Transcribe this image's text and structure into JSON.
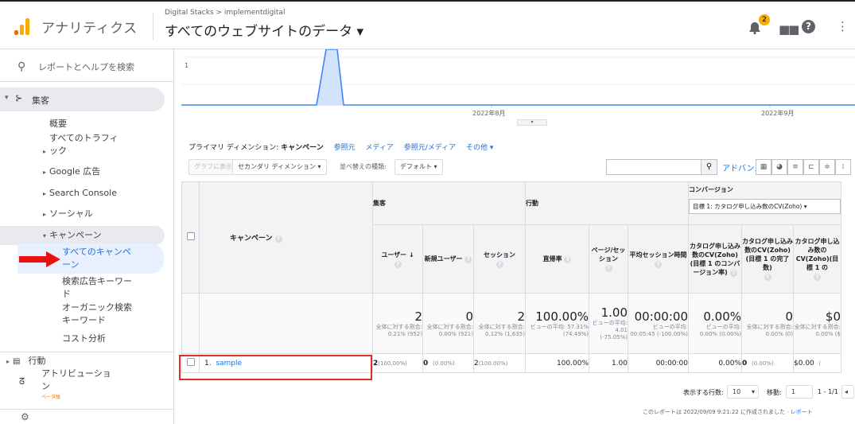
{
  "header": {
    "product": "アナリティクス",
    "breadcrumb": "Digital Stacks > implementdigital",
    "account_view": "すべてのウェブサイトのデータ ▾",
    "notification_count": "2",
    "help_label": "?"
  },
  "sidebar": {
    "search_label": "レポートとヘルプを検索",
    "acquisition": "集客",
    "overview": "概要",
    "all_traffic_1": "すべてのトラフィ",
    "all_traffic_2": "ック",
    "google_ads": "Google 広告",
    "search_console": "Search Console",
    "social": "ソーシャル",
    "campaigns": "キャンペーン",
    "all_campaigns_1": "すべてのキャンペ",
    "all_campaigns_2": "ーン",
    "paid_keywords_1": "検索広告キーワー",
    "paid_keywords_2": "ド",
    "organic_keywords_1": "オーガニック検索",
    "organic_keywords_2": "キーワード",
    "cost_analysis": "コスト分析",
    "behavior": "行動",
    "attribution_1": "アトリビューショ",
    "attribution_2": "ン",
    "beta_label": "ベータ版"
  },
  "chart": {
    "y_tick": "1",
    "x_label_1": "2022年8月",
    "x_label_2": "2022年9月"
  },
  "dimension_bar": {
    "primary_label": "プライマリ ディメンション:",
    "primary_value": "キャンペーン",
    "links": [
      "参照元",
      "メディア",
      "参照元/メディア",
      "その他 ▾"
    ]
  },
  "toolbar": {
    "plot_rows": "グラフに表示",
    "secondary_dimension": "セカンダリ ディメンション ▾",
    "sort_type_label": "並べ替えの種類:",
    "sort_type_value": "デフォルト ▾",
    "advanced": "アドバンス"
  },
  "table": {
    "group_acquisition": "集客",
    "group_behavior": "行動",
    "group_conversion": "コンバージョン",
    "goal_select": "目標 1: カタログ申し込み数のCV(Zoho) ▾",
    "col_campaign": "キャンペーン",
    "col_users": "ユーザー",
    "col_new_users": "新規ユーザー",
    "col_sessions": "セッション",
    "col_bounce": "直帰率",
    "col_pages_session": "ページ/セッション",
    "col_avg_duration": "平均セッション時間",
    "col_goal_cvr": "カタログ申し込み数のCV(Zoho)(目標 1 のコンバージョン率)",
    "col_goal_completions": "カタログ申し込み数のCV(Zoho)(目標 1 の完了数)",
    "col_goal_value": "カタログ申し込み数のCV(Zoho)(目標 1 の",
    "totals": {
      "users": "2",
      "users_sub": "全体に対する割合: 0.21% (952)",
      "new_users": "0",
      "new_users_sub": "全体に対する割合: 0.00% (921)",
      "sessions": "2",
      "sessions_sub": "全体に対する割合: 0.12% (1,635)",
      "bounce": "100.00%",
      "bounce_sub": "ビューの平均: 57.31% (74.49%)",
      "pages": "1.00",
      "pages_sub": "ビューの平均: 4.01 (-75.05%)",
      "duration": "00:00:00",
      "duration_sub": "ビューの平均: 00:05:45 (-100.00%)",
      "cvr": "0.00%",
      "cvr_sub": "ビューの平均: 0.00% (0.00%)",
      "completions": "0",
      "completions_sub": "全体に対する割合: 0.00% (0)",
      "value": "$0",
      "value_sub": "全体に対する割合: 0.00% ($"
    },
    "row": {
      "index": "1.",
      "campaign": "sample",
      "users": "2",
      "users_pct": "(100.00%)",
      "new_users": "0",
      "new_users_pct": "(0.00%)",
      "sessions": "2",
      "sessions_pct": "(100.00%)",
      "bounce": "100.00%",
      "pages": "1.00",
      "duration": "00:00:00",
      "cvr": "0.00%",
      "completions": "0",
      "completions_pct": "(0.00%)",
      "value": "$0.00",
      "value_pct": "("
    }
  },
  "pagination": {
    "rows_label": "表示する行数:",
    "rows_value": "10",
    "goto_label": "移動:",
    "goto_value": "1",
    "range": "1 - 1/1"
  },
  "footer": {
    "text": "このレポートは 2022/09/09 9:21:22 に作成されました · ",
    "link": "レポート"
  },
  "colors": {
    "accent": "#1a73e8",
    "highlight": "#d93025",
    "arrow": "#e8110f",
    "selected_bg": "#e8f0fe"
  }
}
